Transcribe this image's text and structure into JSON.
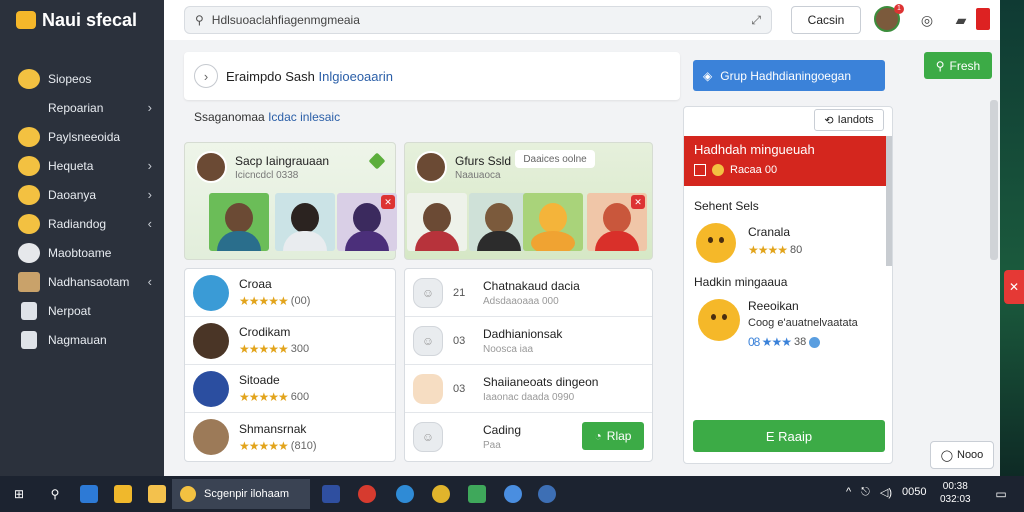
{
  "app": {
    "title": "Naui sfecal"
  },
  "sidebar": {
    "items": [
      {
        "label": "Siopeos",
        "icon": "emoji-icon",
        "chevron": ""
      },
      {
        "label": "Repoarian",
        "icon": "",
        "chevron": "›"
      },
      {
        "label": "Paylsneeoida",
        "icon": "emoji-icon",
        "chevron": ""
      },
      {
        "label": "Hequeta",
        "icon": "emoji-icon",
        "chevron": "›"
      },
      {
        "label": "Daoanya",
        "icon": "emoji-icon",
        "chevron": "›"
      },
      {
        "label": "Radiandog",
        "icon": "emoji-icon",
        "chevron": "‹"
      },
      {
        "label": "Maobtoame",
        "icon": "emoji-icon",
        "chevron": ""
      },
      {
        "label": "Nadhansaotam",
        "icon": "emoji-icon",
        "chevron": "‹"
      },
      {
        "label": "Nerpoat",
        "icon": "doc-icon",
        "chevron": ""
      },
      {
        "label": "Nagmauan",
        "icon": "doc-icon",
        "chevron": ""
      }
    ]
  },
  "topbar": {
    "search_text": "Hdlsuoaclahfiagenmgmeaia",
    "cancel_label": "Cacsin",
    "badge": "1"
  },
  "header": {
    "title_main": "Eraimpdo Sash",
    "title_link": "Inlgioeoaarin"
  },
  "group_button": "Grup Hadhdianingoegan",
  "fresh_button": "Fresh",
  "section": {
    "label": "Ssaganomaa",
    "link": "Icdac inlesaic"
  },
  "group_cards": [
    {
      "name": "Sacp Iaingrauaan",
      "sub": "Icicncdcl 0338",
      "pill": ""
    },
    {
      "name": "Gfurs Ssld",
      "sub": "Naauaoca",
      "pill": "Daaices oolne"
    }
  ],
  "left_list": [
    {
      "name": "Croaa",
      "rating": "★★★★★",
      "count": "(00)"
    },
    {
      "name": "Crodikam",
      "rating": "★★★★★",
      "count": "300"
    },
    {
      "name": "Sitoade",
      "rating": "★★★★★",
      "count": "600"
    },
    {
      "name": "Shmansrnak",
      "rating": "★★★★★",
      "count": "(810)"
    }
  ],
  "mid_list": [
    {
      "num": "21",
      "name": "Chatnakaud dacia",
      "sub": "Adsdaaoaaa 000"
    },
    {
      "num": "03",
      "name": "Dadhianionsak",
      "sub": "Noosca iaa"
    },
    {
      "num": "03",
      "name": "Shaiianeoats dingeon",
      "sub": "Iaaonac daada 0990"
    },
    {
      "num": "",
      "name": "Cading",
      "sub": "Paa",
      "join": "Rlap"
    }
  ],
  "panel": {
    "sort_label": "Iandots",
    "red_title": "Hadhdah mingueuah",
    "red_sub": "Racaa 00",
    "label1": "Sehent Sels",
    "item1_name": "Cranala",
    "item1_rating": "★★★★",
    "item1_count": "80",
    "label2": "Hadkin mingaaua",
    "item2_name": "Reeoikan",
    "item2_desc": "Coog e'auatnelvaatata",
    "item2_rating": "08 ★★★",
    "item2_count": "38",
    "join_label": "E Raaip"
  },
  "more_label": "Nooo",
  "taskbar": {
    "active_app": "Scgenpir ilohaam",
    "time": "0050",
    "date": "00:38\n032:03"
  },
  "colors": {
    "accent_blue": "#3b82d9",
    "accent_green": "#3cab46",
    "accent_red": "#d4261e"
  }
}
